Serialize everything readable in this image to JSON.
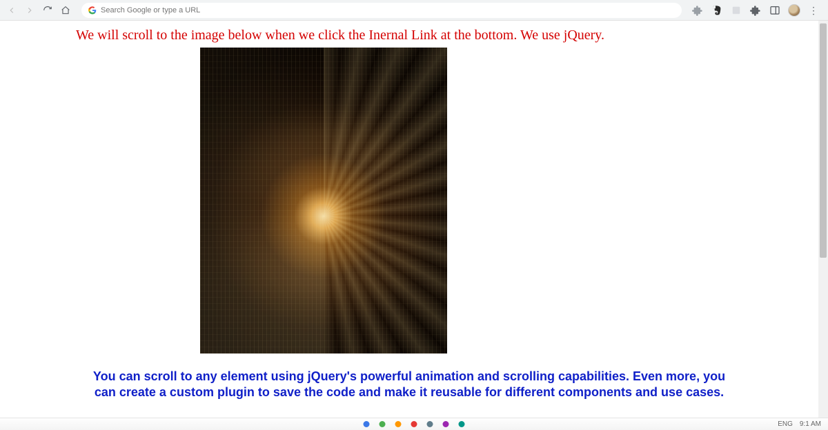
{
  "browser": {
    "omnibox_placeholder": "Search Google or type a URL"
  },
  "page": {
    "heading_red": "We will scroll to the image below when we click the Inernal Link at the bottom. We use jQuery.",
    "blue_paragraph": "You can scroll to any element using jQuery's powerful animation and scrolling capabilities. Even more, you can create a custom plugin to save the code and make it reusable for different components and use cases."
  },
  "taskbar": {
    "lang": "ENG",
    "time": "9:1 AM"
  }
}
